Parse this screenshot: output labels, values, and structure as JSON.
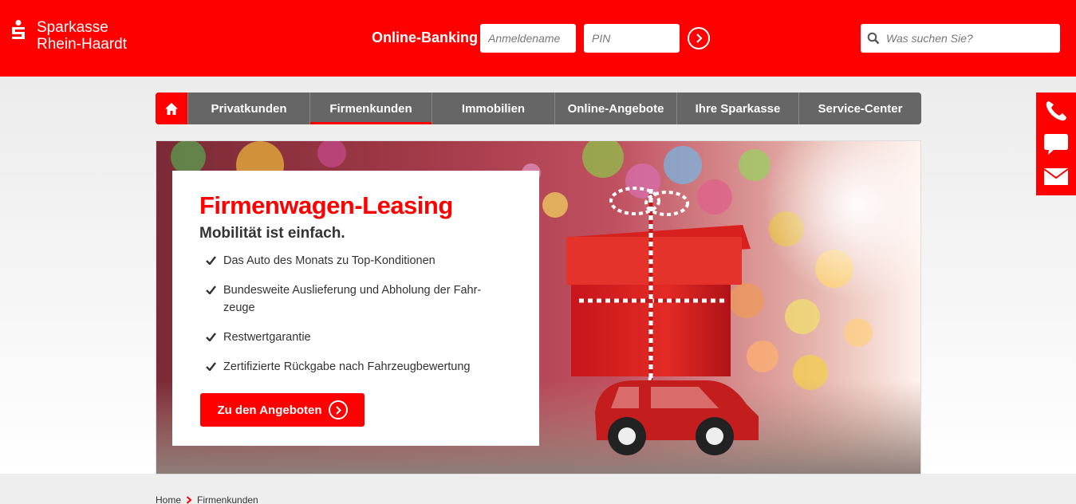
{
  "header": {
    "brand_line1": "Sparkasse",
    "brand_line2": "Rhein-Haardt",
    "online_banking_label": "Online-Banking",
    "username_placeholder": "Anmeldename",
    "pin_placeholder": "PIN",
    "search_placeholder": "Was suchen Sie?",
    "color_brand": "#ff0000"
  },
  "nav": {
    "home_icon": "home-icon",
    "items": [
      {
        "label": "Privatkunden",
        "active": false
      },
      {
        "label": "Firmenkunden",
        "active": true
      },
      {
        "label": "Immobilien",
        "active": false
      },
      {
        "label": "Online-Angebote",
        "active": false
      },
      {
        "label": "Ihre Sparkasse",
        "active": false
      },
      {
        "label": "Service-Center",
        "active": false
      }
    ]
  },
  "side_contact": {
    "icons": [
      "phone-icon",
      "chat-icon",
      "mail-icon"
    ]
  },
  "hero": {
    "title": "Firmenwagen-Leasing",
    "subtitle": "Mobilität ist einfach.",
    "bullets": [
      "Das Auto des Monats zu Top-Konditionen",
      "Bundesweite Auslieferung und Abholung der Fahr-zeuge",
      "Restwertgarantie",
      "Zertifizierte Rückgabe nach Fahrzeugbewertung"
    ],
    "cta_label": "Zu den Angeboten"
  },
  "breadcrumb": {
    "items": [
      "Home",
      "Firmenkunden"
    ]
  }
}
